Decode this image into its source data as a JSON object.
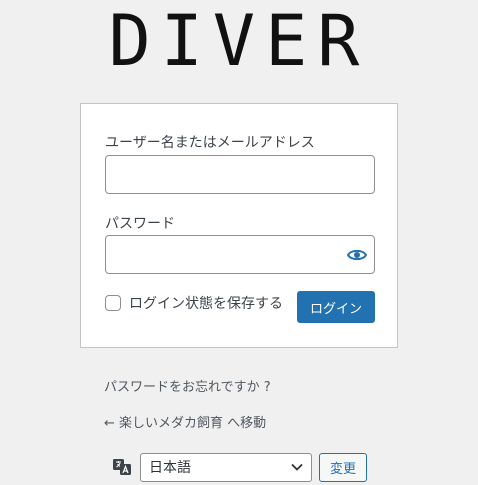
{
  "brand": {
    "logo_text": "DIVER"
  },
  "login_form": {
    "username_label": "ユーザー名またはメールアドレス",
    "username_value": "",
    "password_label": "パスワード",
    "password_value": "",
    "show_password_icon": "eye-icon",
    "remember_label": "ログイン状態を保存する",
    "remember_checked": false,
    "submit_label": "ログイン",
    "accent_color": "#2271b1"
  },
  "links": {
    "lost_password": "パスワードをお忘れですか ?",
    "back_to_site": "← 楽しいメダカ飼育 へ移動"
  },
  "language": {
    "icon": "translation-icon",
    "selected": "日本語",
    "change_label": "変更"
  }
}
